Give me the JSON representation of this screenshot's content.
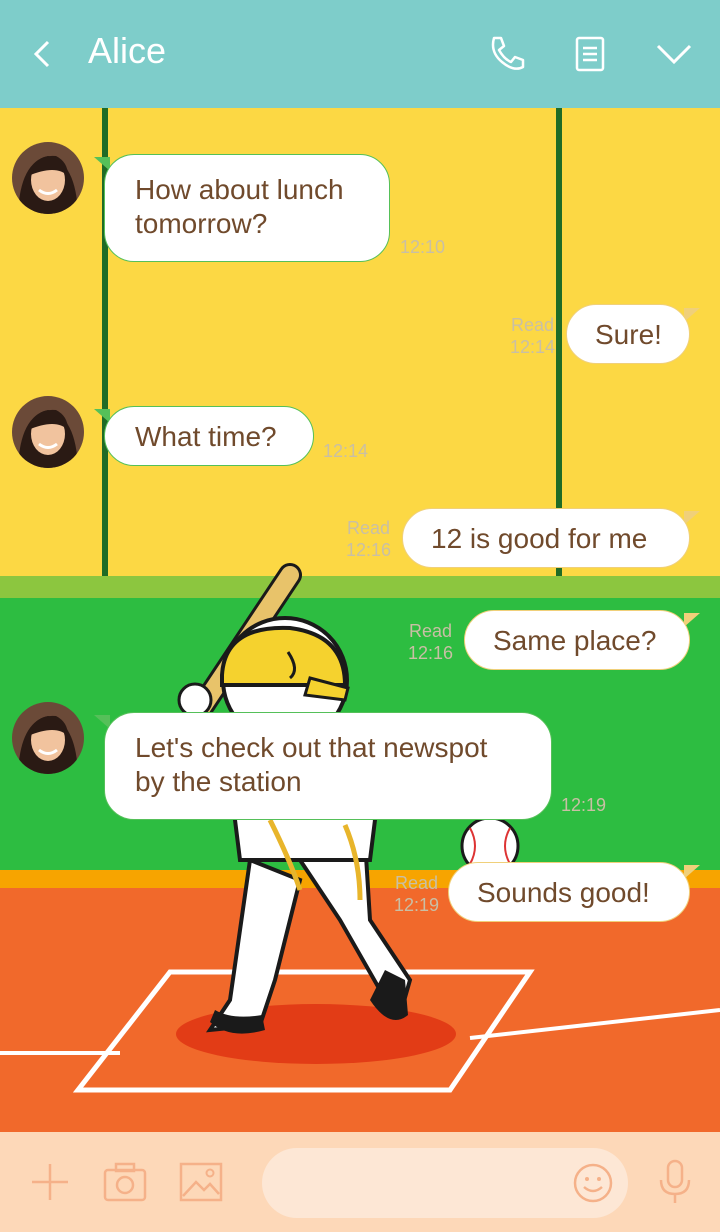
{
  "header": {
    "back_label": "<",
    "title": "Alice",
    "icons": [
      "chevron-left-icon",
      "phone-icon",
      "notes-icon",
      "chevron-down-icon"
    ],
    "color": "#7ecdca"
  },
  "messages": [
    {
      "side": "in",
      "lines": [
        "How about lunch",
        "tomorrow?"
      ],
      "time": "12:10"
    },
    {
      "side": "out",
      "lines": [
        "Sure!"
      ],
      "read": "Read",
      "time": "12:14"
    },
    {
      "side": "in",
      "lines": [
        "What time?"
      ],
      "time": "12:14"
    },
    {
      "side": "out",
      "lines": [
        "12 is good for me"
      ],
      "read": "Read",
      "time": "12:16"
    },
    {
      "side": "out",
      "lines": [
        "Same place?"
      ],
      "read": "Read",
      "time": "12:16"
    },
    {
      "side": "in",
      "lines": [
        "Let's check out that newspot",
        "by the station"
      ],
      "time": "12:19"
    },
    {
      "side": "out",
      "lines": [
        "Sounds good!"
      ],
      "read": "Read",
      "time": "12:19"
    }
  ],
  "footer": {
    "icons": [
      "plus-icon",
      "camera-icon",
      "image-icon",
      "smiley-icon",
      "microphone-icon"
    ],
    "input_placeholder": ""
  },
  "theme": {
    "yellow": "#fcd844",
    "green": "#2dbd41",
    "orange": "#f1692b",
    "text": "#704a2c"
  }
}
